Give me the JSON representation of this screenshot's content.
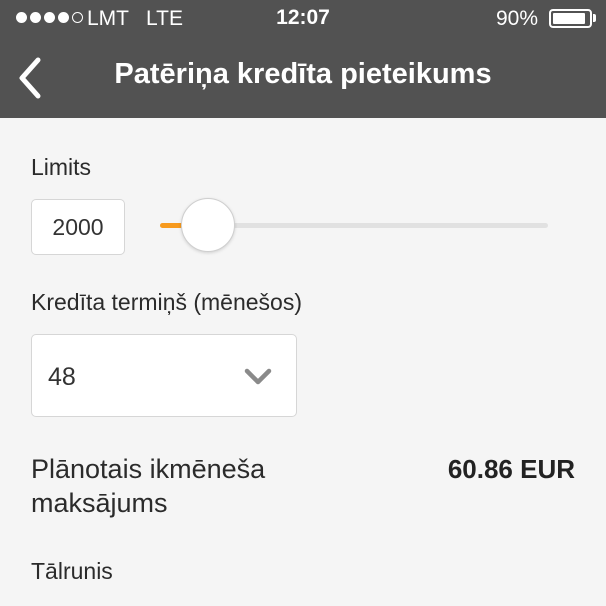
{
  "status_bar": {
    "signal_filled": 4,
    "signal_total": 5,
    "carrier": "LMT",
    "network": "LTE",
    "time": "12:07",
    "battery_percent": "90%",
    "battery_level": 0.9
  },
  "nav": {
    "back_icon": "chevron-left-icon",
    "title": "Patēriņa kredīta pieteikums"
  },
  "form": {
    "limit": {
      "label": "Limits",
      "value": "2000",
      "slider_fraction": 0.06
    },
    "term": {
      "label": "Kredīta termiņš (mēnešos)",
      "selected": "48",
      "icon": "chevron-down-icon"
    },
    "payment": {
      "label": "Plānotais ikmēneša maksājums",
      "value": "60.86 EUR"
    },
    "phone": {
      "label": "Tālrunis"
    }
  },
  "colors": {
    "header_bg": "#525252",
    "accent": "#f79a1e",
    "page_bg": "#f5f5f5"
  }
}
